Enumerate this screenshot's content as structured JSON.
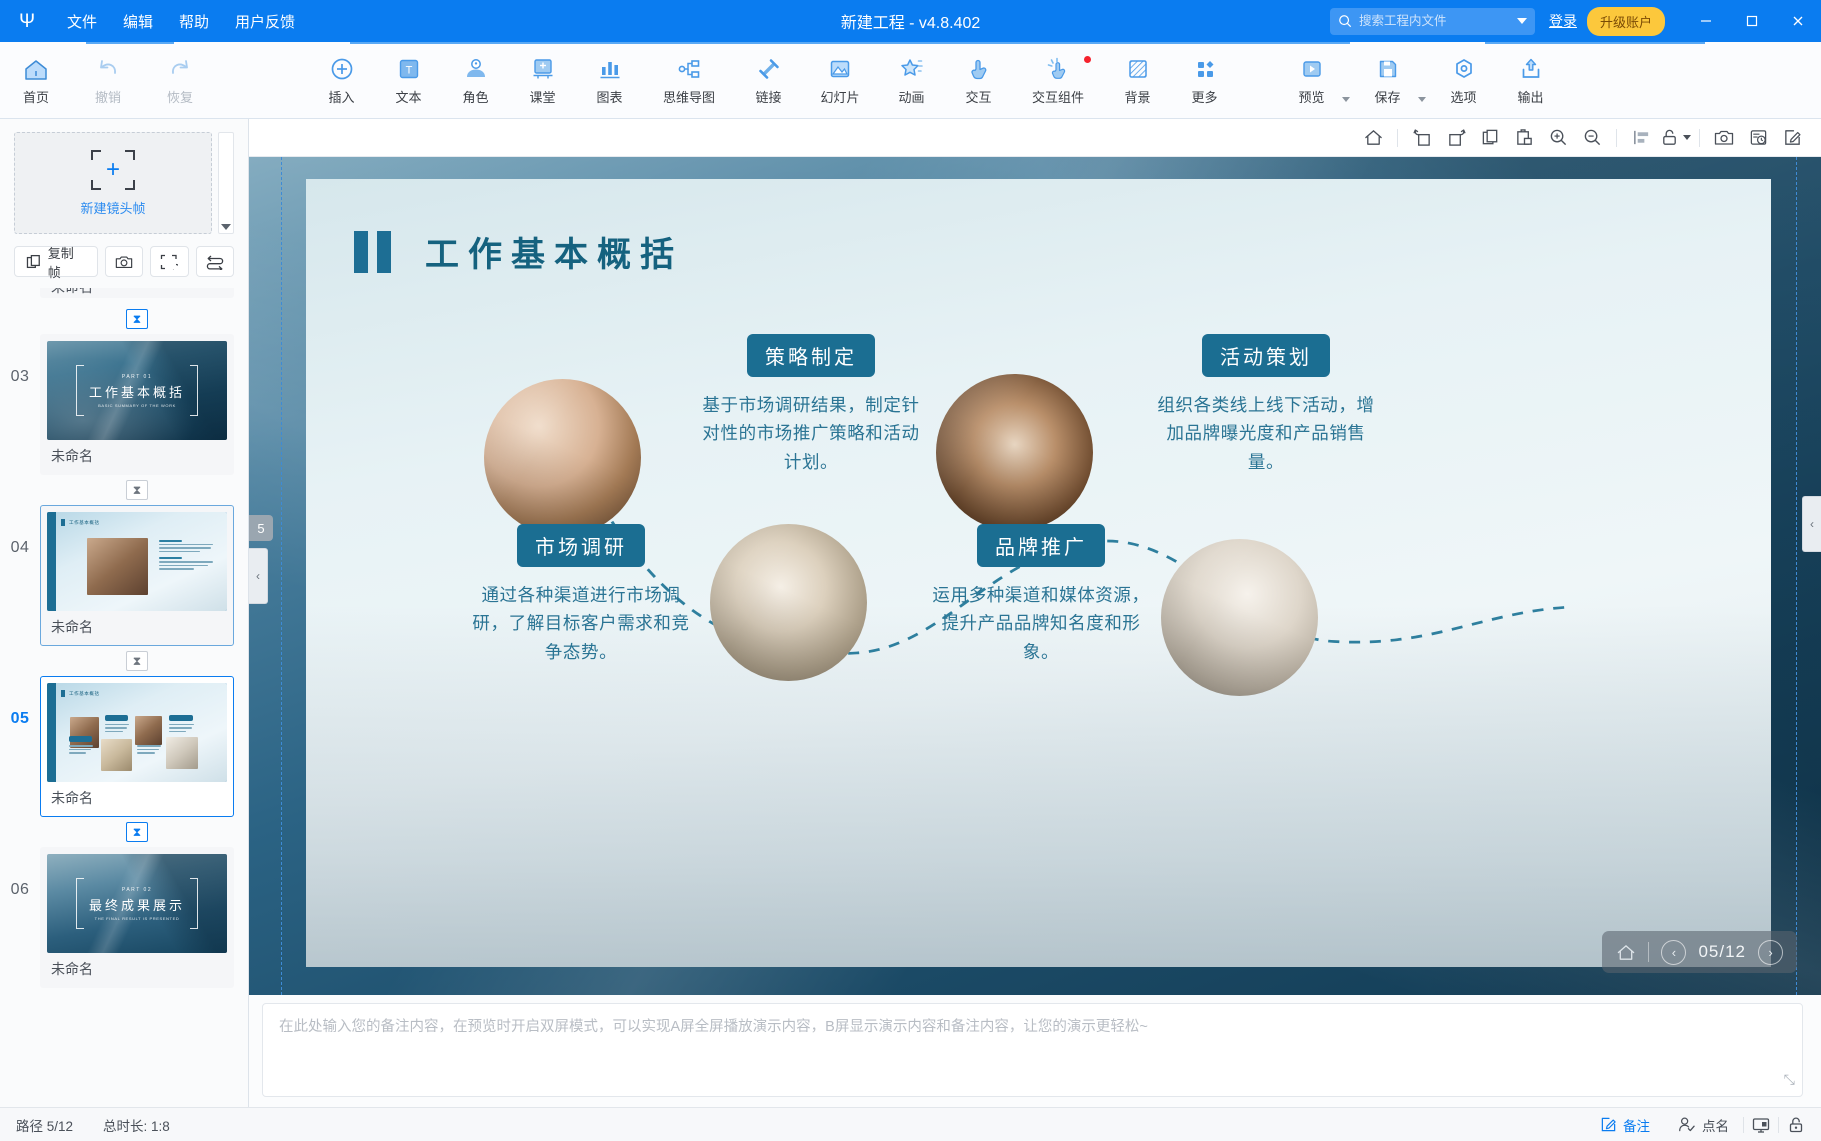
{
  "titlebar": {
    "logo": "logo-icon",
    "menus": [
      "文件",
      "编辑",
      "帮助",
      "用户反馈"
    ],
    "title": "新建工程 - v4.8.402",
    "search_placeholder": "搜索工程内文件",
    "search_value": "",
    "login": "登录",
    "upgrade": "升级账户",
    "minimize": "—",
    "maximize": "□",
    "close": "✕"
  },
  "ribbon": {
    "left_group": [
      {
        "label": "首页",
        "icon": "home-icon",
        "dim": false
      },
      {
        "label": "撤销",
        "icon": "undo-icon",
        "dim": true
      },
      {
        "label": "恢复",
        "icon": "redo-icon",
        "dim": true
      }
    ],
    "main_group": [
      {
        "label": "插入",
        "icon": "plus-circle-icon"
      },
      {
        "label": "文本",
        "icon": "text-box-icon"
      },
      {
        "label": "角色",
        "icon": "person-icon"
      },
      {
        "label": "课堂",
        "icon": "classroom-icon"
      },
      {
        "label": "图表",
        "icon": "bar-chart-icon"
      },
      {
        "label": "思维导图",
        "icon": "mindmap-icon"
      },
      {
        "label": "链接",
        "icon": "link-icon"
      },
      {
        "label": "幻灯片",
        "icon": "slide-icon"
      },
      {
        "label": "动画",
        "icon": "star-animation-icon"
      },
      {
        "label": "交互",
        "icon": "hand-tap-icon"
      },
      {
        "label": "交互组件",
        "icon": "interactive-component-icon",
        "badge": true
      },
      {
        "label": "背景",
        "icon": "background-icon"
      },
      {
        "label": "更多",
        "icon": "more-grid-icon"
      }
    ],
    "right_group": [
      {
        "label": "预览",
        "icon": "preview-play-icon",
        "dropdown": true
      },
      {
        "label": "保存",
        "icon": "save-disk-icon",
        "dropdown": true
      },
      {
        "label": "选项",
        "icon": "options-hex-icon"
      },
      {
        "label": "输出",
        "icon": "export-upload-icon"
      }
    ]
  },
  "left_panel": {
    "new_frame_label": "新建镜头帧",
    "tools": [
      {
        "label": "复制帧",
        "icon": "copy-frame-icon"
      },
      {
        "label": "",
        "icon": "camera-icon"
      },
      {
        "label": "",
        "icon": "fit-frame-icon"
      },
      {
        "label": "",
        "icon": "swap-order-icon"
      }
    ],
    "slides": [
      {
        "num": "",
        "name": "未命名",
        "type": "partial",
        "active": false
      },
      {
        "num": "03",
        "name": "未命名",
        "type": "mountain",
        "title": "工作基本概括",
        "part": "PART 01",
        "subtitle": "BASIC SUMMARY OF THE WORK",
        "active": false
      },
      {
        "num": "04",
        "name": "未命名",
        "type": "content-a",
        "active": false
      },
      {
        "num": "05",
        "name": "未命名",
        "type": "content-b",
        "active": true
      },
      {
        "num": "06",
        "name": "未命名",
        "type": "mountain2",
        "title": "最终成果展示",
        "part": "PART 02",
        "subtitle": "THE FINAL RESULT IS PRESENTED",
        "active": false
      }
    ]
  },
  "canvas_toolbar": [
    {
      "icon": "home-outline-icon"
    },
    {
      "icon": "rotate-left-icon"
    },
    {
      "icon": "rotate-right-icon"
    },
    {
      "icon": "copy-icon"
    },
    {
      "icon": "paste-icon"
    },
    {
      "icon": "zoom-in-icon"
    },
    {
      "icon": "zoom-out-icon"
    },
    {
      "icon": "align-icon"
    },
    {
      "icon": "unlock-icon",
      "dropdown": true
    },
    {
      "icon": "snapshot-icon"
    },
    {
      "icon": "history-icon"
    },
    {
      "icon": "edit-icon"
    }
  ],
  "slide": {
    "title": "工作基本概括",
    "zoom_badge": "5",
    "nodes": [
      {
        "id": "node-1",
        "label": "策略制定",
        "desc": "基于市场调研结果，制定针对性的市场推广策略和活动计划。"
      },
      {
        "id": "node-2",
        "label": "活动策划",
        "desc": "组织各类线上线下活动，增加品牌曝光度和产品销售量。"
      },
      {
        "id": "node-3",
        "label": "市场调研",
        "desc": "通过各种渠道进行市场调研，了解目标客户需求和竞争态势。"
      },
      {
        "id": "node-4",
        "label": "品牌推广",
        "desc": "运用多种渠道和媒体资源，提升产品品牌知名度和形象。"
      }
    ],
    "page_indicator": "05/12",
    "page_home": "home-icon",
    "page_prev": "‹",
    "page_next": "›"
  },
  "notes": {
    "placeholder": "在此处输入您的备注内容，在预览时开启双屏模式，可以实现A屏全屏播放演示内容，B屏显示演示内容和备注内容，让您的演示更轻松~",
    "value": ""
  },
  "statusbar": {
    "path": "路径 5/12",
    "duration": "总时长: 1:8",
    "notes_btn": "备注",
    "rollcall_btn": "点名",
    "presenter_icon": "presenter-screen-icon",
    "lock_icon": "lock-icon"
  },
  "colors": {
    "brand_blue": "#0a7cf0",
    "accent_yellow": "#fcc83c",
    "slide_teal": "#1b6e92",
    "text_teal": "#2a7494"
  }
}
